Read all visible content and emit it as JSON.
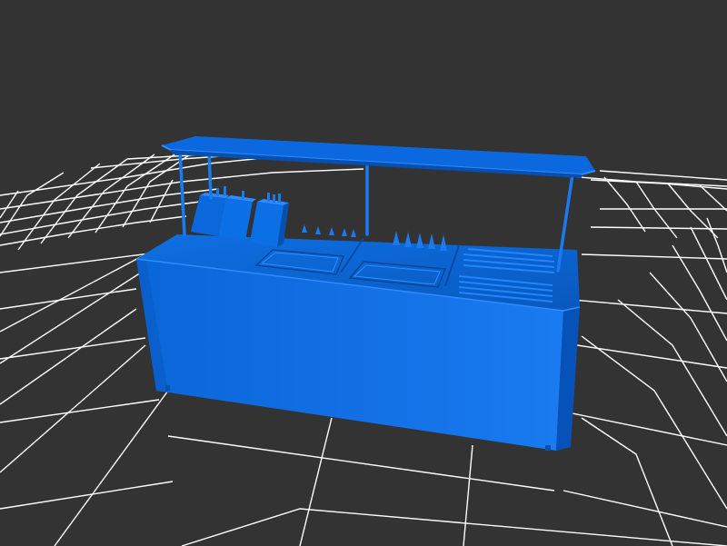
{
  "viewport": {
    "background_color": "#333333",
    "grid_color": "#ffffff"
  },
  "model": {
    "color_primary": "#0a6fe0",
    "color_dark": "#0650b0",
    "color_light": "#2f8cff",
    "color_top": "#0b63cc"
  }
}
